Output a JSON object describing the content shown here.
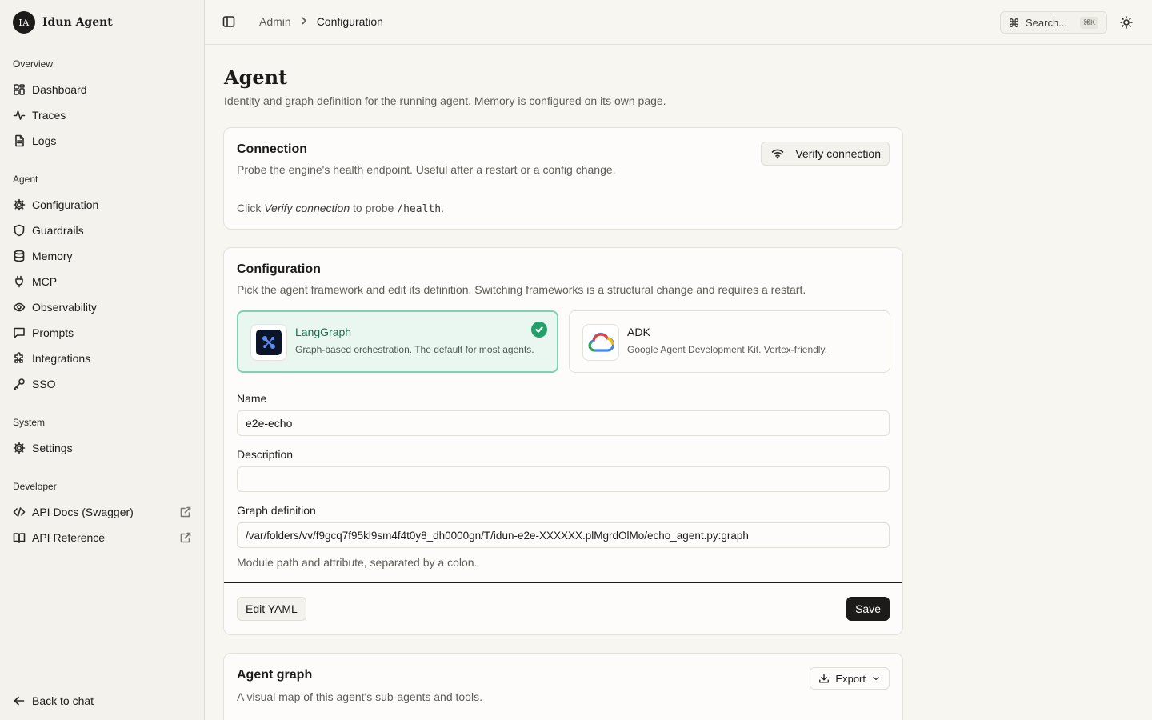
{
  "brand": {
    "initials": "IA",
    "name": "Idun Agent"
  },
  "nav": {
    "overview": {
      "heading": "Overview",
      "items": [
        "Dashboard",
        "Traces",
        "Logs"
      ]
    },
    "agent": {
      "heading": "Agent",
      "items": [
        "Configuration",
        "Guardrails",
        "Memory",
        "MCP",
        "Observability",
        "Prompts",
        "Integrations",
        "SSO"
      ]
    },
    "system": {
      "heading": "System",
      "items": [
        "Settings"
      ]
    },
    "developer": {
      "heading": "Developer",
      "items": [
        "API Docs (Swagger)",
        "API Reference"
      ]
    },
    "back": "Back to chat"
  },
  "topbar": {
    "breadcrumb": [
      "Admin",
      "Configuration"
    ],
    "search_label": "Search...",
    "search_kbd": "⌘K"
  },
  "page": {
    "title": "Agent",
    "subtitle": "Identity and graph definition for the running agent. Memory is configured on its own page."
  },
  "connection": {
    "title": "Connection",
    "subtitle": "Probe the engine's health endpoint. Useful after a restart or a config change.",
    "verify_label": "Verify connection",
    "hint_prefix": "Click",
    "hint_em": "Verify connection",
    "hint_mid": "to probe",
    "hint_code": "/health",
    "hint_suffix": "."
  },
  "configuration": {
    "title": "Configuration",
    "subtitle": "Pick the agent framework and edit its definition. Switching frameworks is a structural change and requires a restart.",
    "frameworks": [
      {
        "name": "LangGraph",
        "desc": "Graph-based orchestration. The default for most agents.",
        "selected": true
      },
      {
        "name": "ADK",
        "desc": "Google Agent Development Kit. Vertex-friendly.",
        "selected": false
      }
    ],
    "name_label": "Name",
    "name_value": "e2e-echo",
    "description_label": "Description",
    "description_value": "",
    "graph_label": "Graph definition",
    "graph_value": "/var/folders/vv/f9gcq7f95kl9sm4f4t0y8_dh0000gn/T/idun-e2e-XXXXXX.plMgrdOlMo/echo_agent.py:graph",
    "graph_help": "Module path and attribute, separated by a colon.",
    "edit_yaml_label": "Edit YAML",
    "save_label": "Save"
  },
  "agent_graph": {
    "title": "Agent graph",
    "subtitle": "A visual map of this agent's sub-agents and tools.",
    "export_label": "Export"
  },
  "colors": {
    "accent": "#22a06b",
    "selected_border": "#7dd3b4",
    "primary_button": "#1c1b19"
  }
}
